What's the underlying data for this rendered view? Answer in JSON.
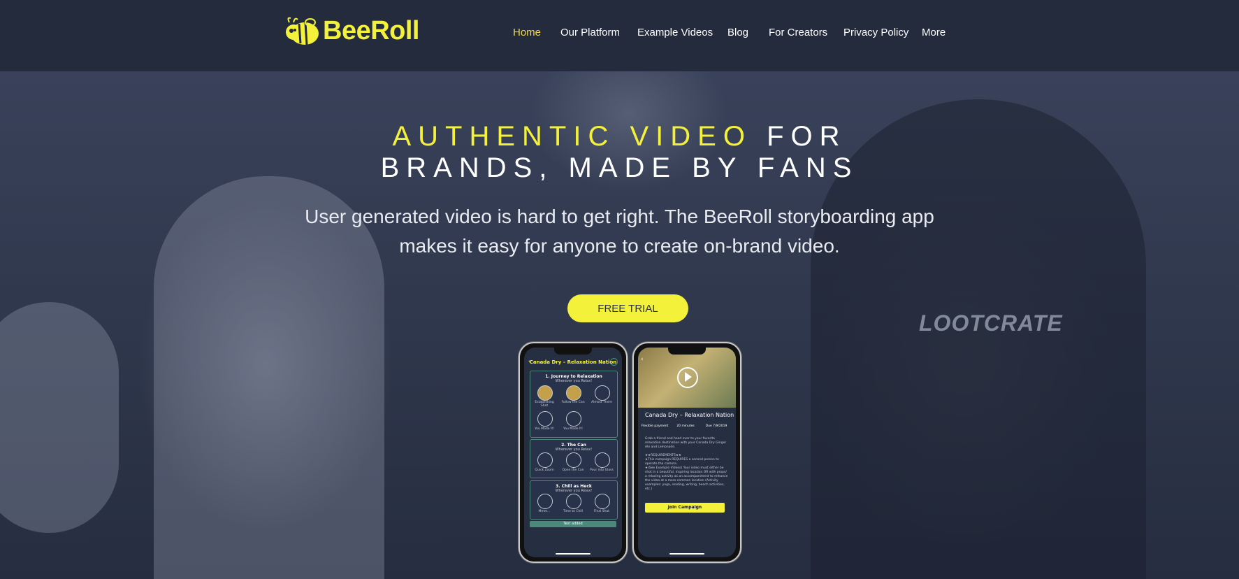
{
  "brand": {
    "name": "BeeRoll",
    "accent": "#f4f13a",
    "nav_active": "#f2d74a",
    "background": "#232b3d"
  },
  "nav": {
    "items": [
      {
        "label": "Home",
        "active": true
      },
      {
        "label": "Our Platform"
      },
      {
        "label": "Example Videos"
      },
      {
        "label": "Blog"
      },
      {
        "label": "For Creators"
      },
      {
        "label": "Privacy Policy"
      },
      {
        "label": "More"
      }
    ]
  },
  "hero": {
    "headline_highlight": "AUTHENTIC VIDEO",
    "headline_rest_1": "FOR",
    "headline_line2": "BRANDS, MADE BY FANS",
    "subtext_line1": "User generated video is hard to get right. The BeeRoll storyboarding app",
    "subtext_line2": "makes it easy for anyone to create on-brand video.",
    "cta_label": "FREE TRIAL",
    "background_text": "LOOTCRATE"
  },
  "phone_left": {
    "title": "Canada Dry – Relaxation Nation",
    "sections": [
      {
        "title": "1. Journey to Relaxation",
        "subtitle": "Wherever you Relax!",
        "shots": [
          "Establishing Shot",
          "Follow the Can",
          "Almost There",
          "You Made It!",
          "You Made It!"
        ]
      },
      {
        "title": "2. The Can",
        "subtitle": "Wherever you Relax!",
        "shots": [
          "Quick Zoom",
          "Open the Can",
          "Pour into Glass"
        ]
      },
      {
        "title": "3. Chill as Heck",
        "subtitle": "Wherever you Relax!",
        "shots": [
          "Mmm...",
          "Time to Chill",
          "Final Shot"
        ]
      }
    ],
    "badge": "Text added"
  },
  "phone_right": {
    "title": "Canada Dry – Relaxation Nation",
    "meta": [
      "Flexible payment",
      "20 minutes",
      "Due 7/9/2019"
    ],
    "body": "Grab a friend and head over to your favorite relaxation destination with your Canada Dry Ginger Ale and Lemonade.\n\n★★REQUIREMENTS★★\n★This campaign REQUIRES a second person to operate the camera.\n★(See Example Videos) Your video must either be shot in a beautiful, inspiring location OR with props/ a relaxing activity as an accompaniment to enhance the video at a more common location (Activity examples: yoga, reading, writing, beach activities, etc.)",
    "join_label": "Join Campaign"
  }
}
